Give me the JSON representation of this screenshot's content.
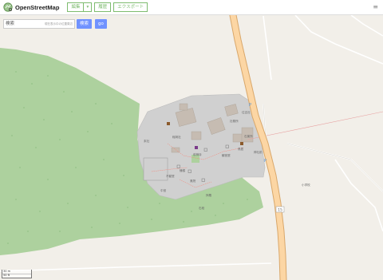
{
  "header": {
    "app_name": "OpenStreetMap",
    "edit_label": "編集",
    "edit_dropdown": "▾",
    "history_label": "履歴",
    "export_label": "エクスポート",
    "menu_icon": "hamburger-icon"
  },
  "search": {
    "value": "検索",
    "hint": "現在表示中の位置周辺",
    "search_label": "検索",
    "go_label": "go"
  },
  "map": {
    "road_shield": "15",
    "labels": {
      "l1": "社務所",
      "l2": "住吉社",
      "l3": "稲荷社",
      "l4": "石楽所",
      "l5": "前神寺",
      "l6": "観音堂",
      "l7": "末社",
      "l8": "不動堂",
      "l9": "中宮",
      "l10": "鐘楼",
      "l11": "奥院",
      "l12": "拝殿",
      "l13": "石段",
      "l14": "鳥居",
      "l15": "神社前",
      "l16": "小学校"
    },
    "parking_label": "P"
  },
  "scale": {
    "top": "30 m",
    "bottom": "50 ft"
  },
  "colors": {
    "brand": "#7ebc6f",
    "accent": "#7092ff",
    "forest": "#add19e",
    "road_primary": "#fcd6a4",
    "background": "#f2efe9",
    "building_area": "#d0d0d0"
  }
}
